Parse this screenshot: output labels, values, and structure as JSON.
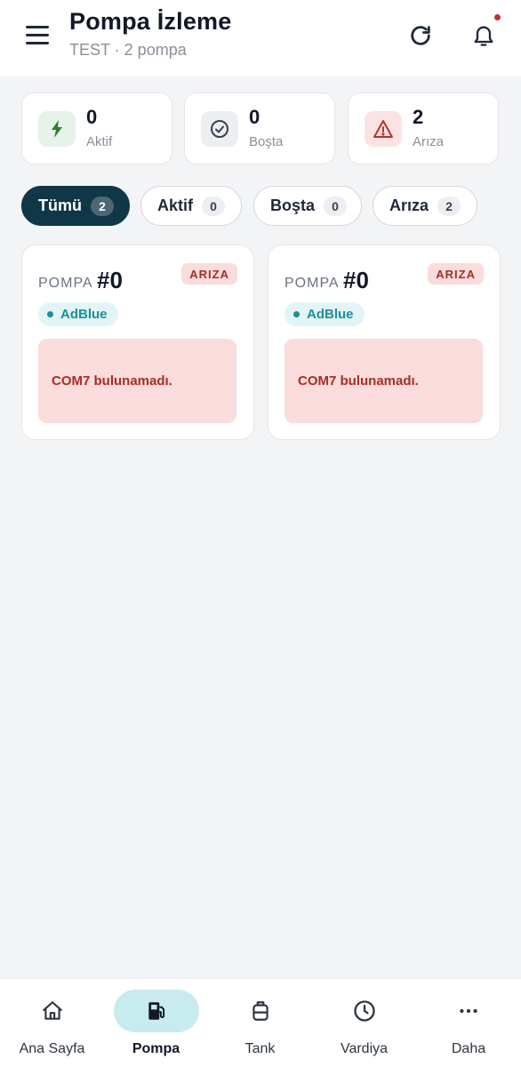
{
  "header": {
    "title": "Pompa İzleme",
    "subtitle": "TEST · 2 pompa",
    "menu_icon": "hamburger-icon",
    "refresh_icon": "refresh-icon",
    "bell_icon": "bell-icon"
  },
  "stats": [
    {
      "value": "0",
      "label": "Aktif",
      "icon": "bolt-icon",
      "color": "#2e7d32",
      "bg": "#e6f3e8"
    },
    {
      "value": "0",
      "label": "Boşta",
      "icon": "check-circle-icon",
      "color": "#374151",
      "bg": "#eceef0"
    },
    {
      "value": "2",
      "label": "Arıza",
      "icon": "warning-icon",
      "color": "#b3332c",
      "bg": "#fbe3e2"
    }
  ],
  "filters": [
    {
      "label": "Tümü",
      "count": "2",
      "active": true
    },
    {
      "label": "Aktif",
      "count": "0"
    },
    {
      "label": "Boşta",
      "count": "0"
    },
    {
      "label": "Arıza",
      "count": "2"
    }
  ],
  "pumps": [
    {
      "prefix": "POMPA",
      "number": "#0",
      "status": "ARIZA",
      "fuel": "AdBlue",
      "message": "COM7 bulunamadı."
    },
    {
      "prefix": "POMPA",
      "number": "#0",
      "status": "ARIZA",
      "fuel": "AdBlue",
      "message": "COM7 bulunamadı."
    }
  ],
  "nav": [
    {
      "label": "Ana Sayfa",
      "icon": "home-icon"
    },
    {
      "label": "Pompa",
      "icon": "fuel-pump-icon",
      "active": true
    },
    {
      "label": "Tank",
      "icon": "tank-icon"
    },
    {
      "label": "Vardiya",
      "icon": "clock-icon"
    },
    {
      "label": "Daha",
      "icon": "more-icon"
    }
  ],
  "colors": {
    "accent_dark": "#0f3747",
    "fault_bg": "#f9dcdb",
    "fault_text": "#a62d27",
    "adblue": "#1a8f99",
    "nav_active_bg": "#c8ebee"
  }
}
